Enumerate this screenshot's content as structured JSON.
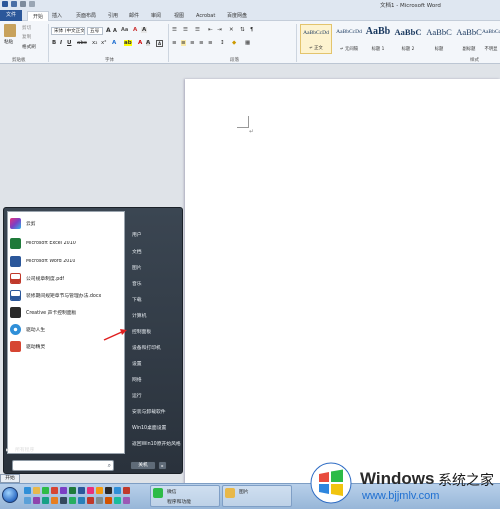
{
  "window": {
    "title": "文档1 - Microsoft Word"
  },
  "ribbon": {
    "tabs": [
      "文件",
      "开始",
      "插入",
      "页面布局",
      "引用",
      "邮件",
      "审阅",
      "视图",
      "Acrobat",
      "百度网盘"
    ],
    "active_tab": "开始",
    "clipboard": {
      "paste": "粘贴",
      "cut": "剪切",
      "copy": "复制",
      "format_painter": "格式刷",
      "label": "剪贴板"
    },
    "font": {
      "name": "宋体 (中文正文)",
      "size": "五号",
      "label": "字体"
    },
    "paragraph": {
      "label": "段落"
    },
    "styles": {
      "label": "样式",
      "items": [
        {
          "sample": "AaBbCcDd",
          "name": "↵ 正文"
        },
        {
          "sample": "AaBbCcDd",
          "name": "↵ 无间隔"
        },
        {
          "sample": "AaBb",
          "name": "标题 1"
        },
        {
          "sample": "AaBbC",
          "name": "标题 2"
        },
        {
          "sample": "AaBbC",
          "name": "标题"
        },
        {
          "sample": "AaBbC",
          "name": "副标题"
        },
        {
          "sample": "AaBbCcDd",
          "name": "不明显"
        }
      ]
    }
  },
  "document": {
    "paragraph_mark": "↵"
  },
  "start_menu": {
    "programs": [
      {
        "label": "云剪",
        "color": "#7b3fc4"
      },
      {
        "label": "Microsoft Excel 2010",
        "color": "#1f7a3a"
      },
      {
        "label": "Microsoft Word 2010",
        "color": "#2b579a"
      },
      {
        "label": "公司规章制度.pdf",
        "color": "#c0392b"
      },
      {
        "label": "装修期间规矩章节与管理办法.docx",
        "color": "#2b579a"
      },
      {
        "label": "Creative 声卡控制面板",
        "color": "#2a2a2a"
      },
      {
        "label": "驱动人生",
        "color": "#2f8fd8"
      },
      {
        "label": "驱动精灵",
        "color": "#d64532"
      }
    ],
    "all_programs": "所有程序",
    "right_links": [
      "用户",
      "文档",
      "图片",
      "音乐",
      "下载",
      "计算机",
      "控制面板",
      "设备和打印机",
      "设置",
      "网络",
      "运行",
      "安装与卸载软件",
      "Win10桌面设置",
      "返回Win10原开始风格"
    ],
    "shutdown": "关机",
    "start_label": "开始"
  },
  "taskbar": {
    "buttons": [
      {
        "label": "微信",
        "label2": "程序和功能",
        "color": "#2dbb47"
      },
      {
        "label": "图片",
        "label2": "",
        "color": "#e8b84a"
      }
    ]
  },
  "watermark": {
    "brand": "Windows",
    "brand_cn": "系统之家",
    "url": "www.bjjmlv.com"
  }
}
